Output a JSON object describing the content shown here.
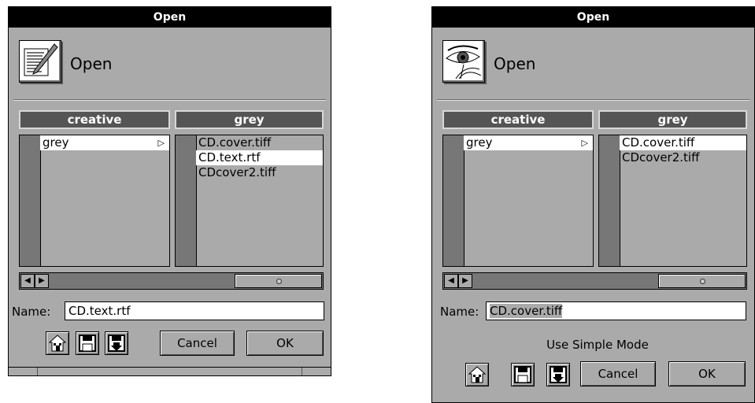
{
  "left_panel": {
    "title": "Open",
    "heading": "Open",
    "app_icon": "edit-document-icon",
    "columns": [
      {
        "header": "creative",
        "items": [
          {
            "label": "grey",
            "selected": true,
            "has_children": true
          }
        ]
      },
      {
        "header": "grey",
        "items": [
          {
            "label": "CD.cover.tiff",
            "selected": false
          },
          {
            "label": "CD.text.rtf",
            "selected": true
          },
          {
            "label": "CDcover2.tiff",
            "selected": false
          }
        ]
      }
    ],
    "name_label": "Name:",
    "name_value": "CD.text.rtf",
    "buttons": {
      "home_icon": "home-icon",
      "disk_icon": "disk-icon",
      "disk_arrow_icon": "disk-arrow-icon",
      "cancel": "Cancel",
      "ok": "OK"
    }
  },
  "right_panel": {
    "title": "Open",
    "heading": "Open",
    "app_icon": "eye-drawing-icon",
    "columns": [
      {
        "header": "creative",
        "items": [
          {
            "label": "grey",
            "selected": true,
            "has_children": true
          }
        ]
      },
      {
        "header": "grey",
        "items": [
          {
            "label": "CD.cover.tiff",
            "selected": true
          },
          {
            "label": "CDcover2.tiff",
            "selected": false
          }
        ]
      }
    ],
    "name_label": "Name:",
    "name_value": "CD.cover.tiff",
    "simple_mode": "Use Simple Mode",
    "buttons": {
      "home_icon": "home-icon",
      "disk_icon": "disk-icon",
      "disk_arrow_icon": "disk-arrow-icon",
      "cancel": "Cancel",
      "ok": "OK"
    }
  },
  "symbols": {
    "scroll_left": "◀",
    "scroll_right": "▶",
    "branch_arrow": "▷"
  }
}
